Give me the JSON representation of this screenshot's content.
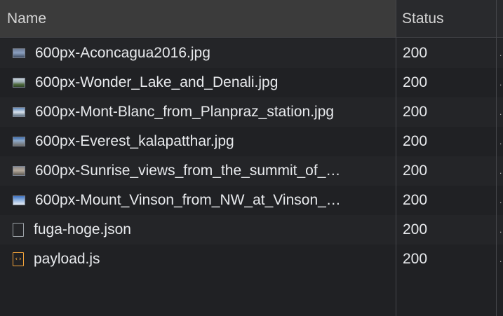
{
  "header": {
    "name": "Name",
    "status": "Status"
  },
  "rows": [
    {
      "name": "600px-Aconcagua2016.jpg",
      "status": "200",
      "icon": "image-thumbnail-icon",
      "thumb": "linear-gradient(180deg,#6f7f99 0%,#8aa0c0 45%,#3d4a5e 100%)"
    },
    {
      "name": "600px-Wonder_Lake_and_Denali.jpg",
      "status": "200",
      "icon": "image-thumbnail-icon",
      "thumb": "linear-gradient(180deg,#c9d3da 0%,#9fb0b6 40%,#4f6a3e 70%,#2f4426 100%)"
    },
    {
      "name": "600px-Mont-Blanc_from_Planpraz_station.jpg",
      "status": "200",
      "icon": "image-thumbnail-icon",
      "thumb": "linear-gradient(180deg,#5d86b8 0%,#d8e2ec 50%,#5a6c7d 100%)"
    },
    {
      "name": "600px-Everest_kalapatthar.jpg",
      "status": "200",
      "icon": "image-thumbnail-icon",
      "thumb": "linear-gradient(180deg,#3d6fb0 0%,#8fa9c8 40%,#6c6a66 100%)"
    },
    {
      "name": "600px-Sunrise_views_from_the_summit_of_…",
      "status": "200",
      "icon": "image-thumbnail-icon",
      "thumb": "linear-gradient(180deg,#8c8a8a 0%,#b5a99b 45%,#5a5650 100%)"
    },
    {
      "name": "600px-Mount_Vinson_from_NW_at_Vinson_…",
      "status": "200",
      "icon": "image-thumbnail-icon",
      "thumb": "linear-gradient(180deg,#3f74c4 0%,#8fb2e0 45%,#e8eef5 100%)"
    },
    {
      "name": "fuga-hoge.json",
      "status": "200",
      "icon": "document-icon"
    },
    {
      "name": "payload.js",
      "status": "200",
      "icon": "script-file-icon",
      "glyph": "‹›"
    }
  ]
}
